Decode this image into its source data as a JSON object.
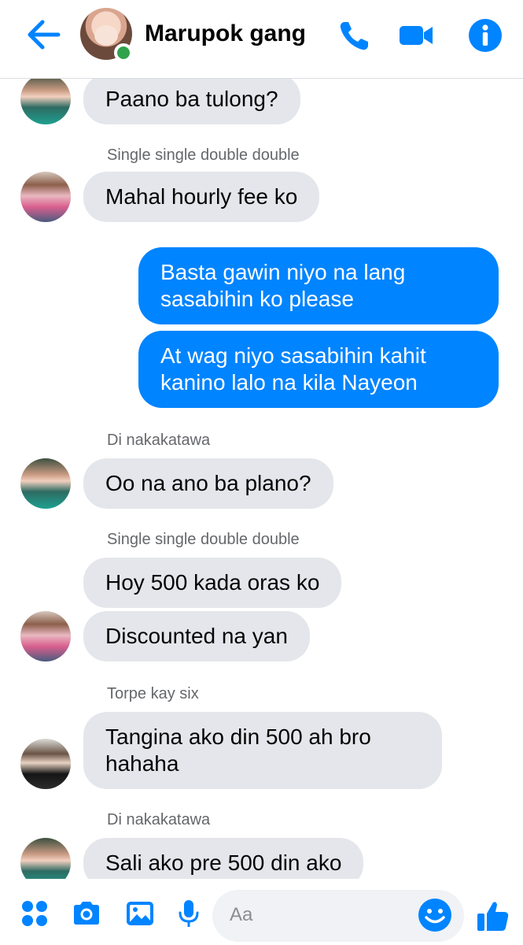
{
  "header": {
    "title": "Marupok gang",
    "accent": "#0084ff",
    "online_color": "#31a24c"
  },
  "messages": {
    "m1": {
      "text": "Paano ba tulong?"
    },
    "sender_single_1": "Single single double double",
    "m2": {
      "text": "Mahal hourly fee ko"
    },
    "out1_line1": "Basta gawin niyo na lang",
    "out1_line2": "sasabihin ko please",
    "out2_line1": "At wag niyo sasabihin kahit",
    "out2_line2": "kanino lalo na kila Nayeon",
    "sender_di_1": "Di nakakatawa",
    "m3": {
      "text": "Oo na ano ba plano?"
    },
    "sender_single_2": "Single single double double",
    "m4": {
      "text": "Hoy 500 kada oras ko"
    },
    "m5": {
      "text": "Discounted na yan"
    },
    "sender_torpe": "Torpe kay six",
    "m6_line1": "Tangina ako din 500 ah bro",
    "m6_line2": "hahaha",
    "sender_di_2": "Di nakakatawa",
    "m7": {
      "text": "Sali ako pre 500 din ako"
    }
  },
  "composer": {
    "placeholder": "Aa",
    "icons": [
      "apps-icon",
      "camera-icon",
      "image-icon",
      "microphone-icon",
      "emoji-icon",
      "thumbs-up-icon"
    ]
  },
  "colors": {
    "incoming_bubble": "#e4e6eb",
    "outgoing_bubble": "#0084ff"
  }
}
